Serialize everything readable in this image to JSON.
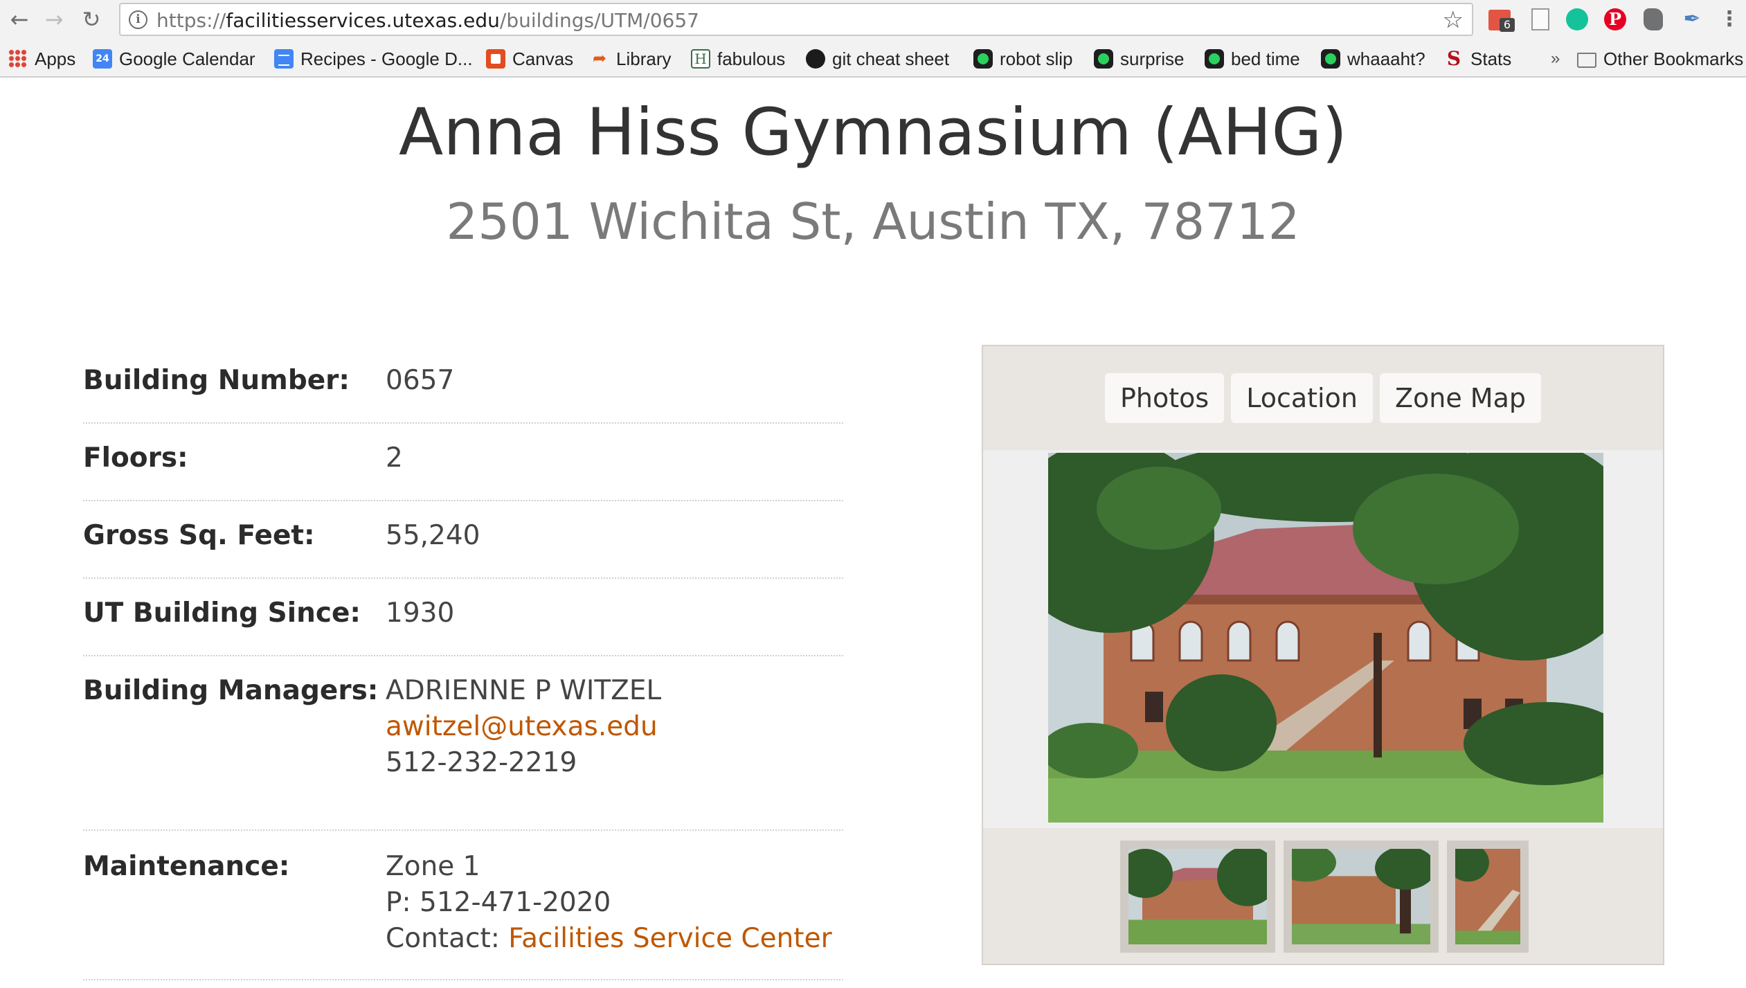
{
  "browser": {
    "url_scheme": "https://",
    "url_host": "facilitiesservices.utexas.edu",
    "url_path": "/buildings/UTM/0657",
    "calendar_badge": "6",
    "bookmarks": [
      {
        "label": "Apps",
        "icon": "apps-grid-icon"
      },
      {
        "label": "Google Calendar",
        "icon": "google-calendar-icon"
      },
      {
        "label": "Recipes - Google D...",
        "icon": "google-docs-icon"
      },
      {
        "label": "Canvas",
        "icon": "canvas-icon"
      },
      {
        "label": "Library",
        "icon": "library-icon"
      },
      {
        "label": "fabulous",
        "icon": "fabulous-icon"
      },
      {
        "label": "git cheat sheet",
        "icon": "github-icon"
      },
      {
        "label": "robot slip",
        "icon": "green-dot-icon"
      },
      {
        "label": "surprise",
        "icon": "green-dot-icon"
      },
      {
        "label": "bed time",
        "icon": "green-dot-icon"
      },
      {
        "label": "whaaaht?",
        "icon": "green-dot-icon"
      },
      {
        "label": "Stats",
        "icon": "stanford-icon"
      },
      {
        "label": "Other Bookmarks",
        "icon": "folder-icon"
      }
    ],
    "calendar_icon_text": "24",
    "overflow_label": "»"
  },
  "building": {
    "title": "Anna Hiss Gymnasium (AHG)",
    "address": "2501 Wichita St, Austin TX, 78712"
  },
  "details": [
    {
      "label": "Building Number:",
      "value": "0657"
    },
    {
      "label": "Floors:",
      "value": "2"
    },
    {
      "label": "Gross Sq. Feet:",
      "value": "55,240"
    },
    {
      "label": "UT Building Since:",
      "value": "1930"
    }
  ],
  "managers": {
    "label": "Building Managers:",
    "name": "ADRIENNE P WITZEL",
    "email": "awitzel@utexas.edu",
    "phone": "512-232-2219"
  },
  "maintenance": {
    "label": "Maintenance:",
    "zone": "Zone 1",
    "phone": "P: 512-471-2020",
    "contact_prefix": "Contact: ",
    "contact_link": "Facilities Service Center"
  },
  "media": {
    "tabs": [
      "Photos",
      "Location",
      "Zone Map"
    ],
    "thumbnail_count": 3
  },
  "colors": {
    "link": "#bf5700",
    "panel_bg": "#e9e6e1"
  }
}
